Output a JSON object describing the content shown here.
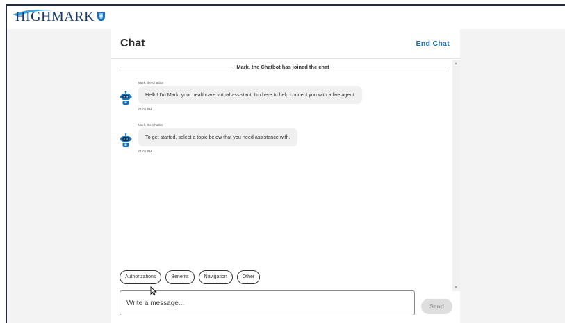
{
  "brand": {
    "logo_text": "HIGHMARK",
    "primary_color": "#163a6b",
    "accent_color": "#3aa6dd",
    "link_color": "#1f6fb2"
  },
  "header": {
    "title": "Chat",
    "end_chat_label": "End Chat"
  },
  "messages": {
    "joined_notice": "Mark, the Chatbot has joined the chat",
    "items": [
      {
        "sender": "Mark, the Chatbot",
        "text": "Hello! I'm Mark, your healthcare virtual assistant. I'm here to help connect you with a live agent.",
        "time": "01:05 PM",
        "avatar_icon": "robot-icon"
      },
      {
        "sender": "Mark, the Chatbot",
        "text": "To get started, select a topic below that you need assistance with.",
        "time": "01:05 PM",
        "avatar_icon": "robot-icon"
      }
    ]
  },
  "quick_replies": [
    "Authorizations",
    "Benefits",
    "Navigation",
    "Other"
  ],
  "composer": {
    "placeholder": "Write a message...",
    "value": "",
    "send_label": "Send"
  }
}
